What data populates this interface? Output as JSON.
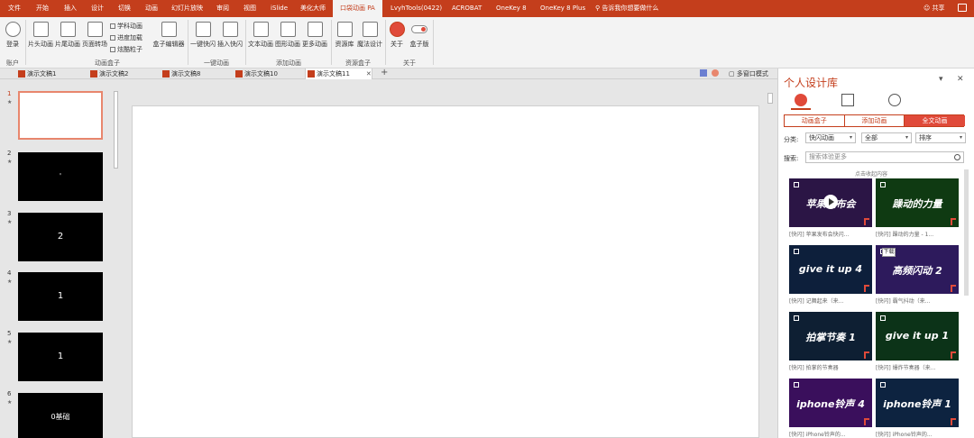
{
  "menubar": {
    "tabs": [
      "文件",
      "开始",
      "插入",
      "设计",
      "切换",
      "动画",
      "幻灯片放映",
      "审阅",
      "视图",
      "iSlide",
      "美化大师",
      "口袋动画 PA",
      "LvyhTools(0422)",
      "ACROBAT",
      "OneKey 8",
      "OneKey 8 Plus"
    ],
    "active_tab": "口袋动画 PA",
    "tell_me": "告诉我你想要做什么",
    "share": "共享"
  },
  "ribbon": {
    "login": "登录",
    "account_group": "账户",
    "piantou": "片头动画",
    "pianwei": "片尾动画",
    "yemian": "页面转场",
    "xueke": "学科动画",
    "jindu": "进度加载",
    "lizi": "炫酷粒子",
    "hezi_editor": "盒子编辑器",
    "anim_box_group": "动画盒子",
    "yijian_shan": "一键快闪",
    "charu_shan": "插入快闪",
    "yijian_group": "一键动画",
    "wenben": "文本动画",
    "tuxing": "图形动画",
    "gengduo": "更多动画",
    "add_group": "添加动画",
    "sucai": "资源库",
    "moshu": "魔法设计",
    "res_group": "资源盒子",
    "guanyu": "关于",
    "hezi_ban": "盒子版",
    "about_group": "关于"
  },
  "doctabs": {
    "tabs": [
      "演示文稿1",
      "演示文稿2",
      "演示文稿8",
      "演示文稿10",
      "演示文稿11"
    ],
    "active": "演示文稿11",
    "multiwindow": "多窗口模式"
  },
  "thumbnails": [
    {
      "num": "1",
      "text": ""
    },
    {
      "num": "2",
      "text": "'"
    },
    {
      "num": "3",
      "text": "2"
    },
    {
      "num": "4",
      "text": "1"
    },
    {
      "num": "5",
      "text": "1"
    },
    {
      "num": "6",
      "text": "0基础"
    }
  ],
  "panel": {
    "title": "个人设计库",
    "segments": [
      "动画盒子",
      "添加动画",
      "全文动画"
    ],
    "active_segment": "全文动画",
    "category_label": "分类:",
    "category_value": "快闪动画",
    "all_value": "全部",
    "sort_value": "排序",
    "search_label": "搜索:",
    "search_placeholder": "搜索体验更多",
    "hint": "点击收起内容",
    "download_tip": "下载",
    "cards": [
      {
        "title": "苹果发布会",
        "caption": "[快闪] 苹果发布会快闪...",
        "color": "#2b1545"
      },
      {
        "title": "躁动的力量",
        "caption": "[快闪] 躁动的力量 - 1...",
        "color": "#0f3a12"
      },
      {
        "title": "give it up 4",
        "caption": "[快闪] 记舞起来（来...",
        "color": "#0d1f3b"
      },
      {
        "title": "高频闪动 2",
        "caption": "[快闪] 霸气抖动（来...",
        "color": "#2d1a5c"
      },
      {
        "title": "拍掌节奏 1",
        "caption": "[快闪] 拍掌的节奏器",
        "color": "#0e1f33"
      },
      {
        "title": "give it up 1",
        "caption": "[快闪] 爆炸节奏器（来...",
        "color": "#0c3318"
      },
      {
        "title": "iphone铃声 4",
        "caption": "[快闪] iPhone铃声的...",
        "color": "#3a0f5c"
      },
      {
        "title": "iphone铃声 1",
        "caption": "[快闪] iPhone铃声的...",
        "color": "#0d2340"
      }
    ]
  },
  "colors": {
    "accent": "#c43e1c",
    "active_segment": "#e04a3a"
  }
}
